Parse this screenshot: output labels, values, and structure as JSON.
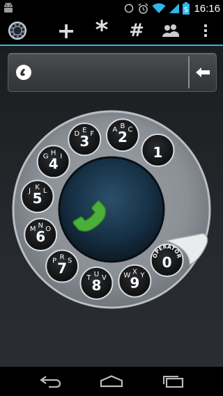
{
  "status_bar": {
    "time": "16:16",
    "battery_glyph": "$",
    "icons": [
      "android-icon",
      "sync-icon",
      "alarm-icon",
      "wifi-icon",
      "signal-icon",
      "battery-icon"
    ]
  },
  "toolbar": {
    "items": [
      {
        "name": "rotary-dial-icon"
      },
      {
        "name": "add-contact",
        "label": "+"
      },
      {
        "name": "star-key",
        "label": "*"
      },
      {
        "name": "hash-key",
        "label": "#"
      },
      {
        "name": "contacts-icon"
      },
      {
        "name": "overflow-menu-icon"
      }
    ],
    "accent": "#33b5e5"
  },
  "number_field": {
    "value": "",
    "placeholder": ""
  },
  "dial": {
    "holes": [
      {
        "digit": "1",
        "letters": ""
      },
      {
        "digit": "2",
        "letters": "ABC"
      },
      {
        "digit": "3",
        "letters": "DEF"
      },
      {
        "digit": "4",
        "letters": "GHI"
      },
      {
        "digit": "5",
        "letters": "JKL"
      },
      {
        "digit": "6",
        "letters": "MNO"
      },
      {
        "digit": "7",
        "letters": "PRS"
      },
      {
        "digit": "8",
        "letters": "TUV"
      },
      {
        "digit": "9",
        "letters": "WXY"
      },
      {
        "digit": "0",
        "letters": "OPERATOR"
      }
    ],
    "call_color": "#4caf3a"
  },
  "nav_bar": {
    "items": [
      "back-icon",
      "home-icon",
      "recent-apps-icon"
    ]
  }
}
